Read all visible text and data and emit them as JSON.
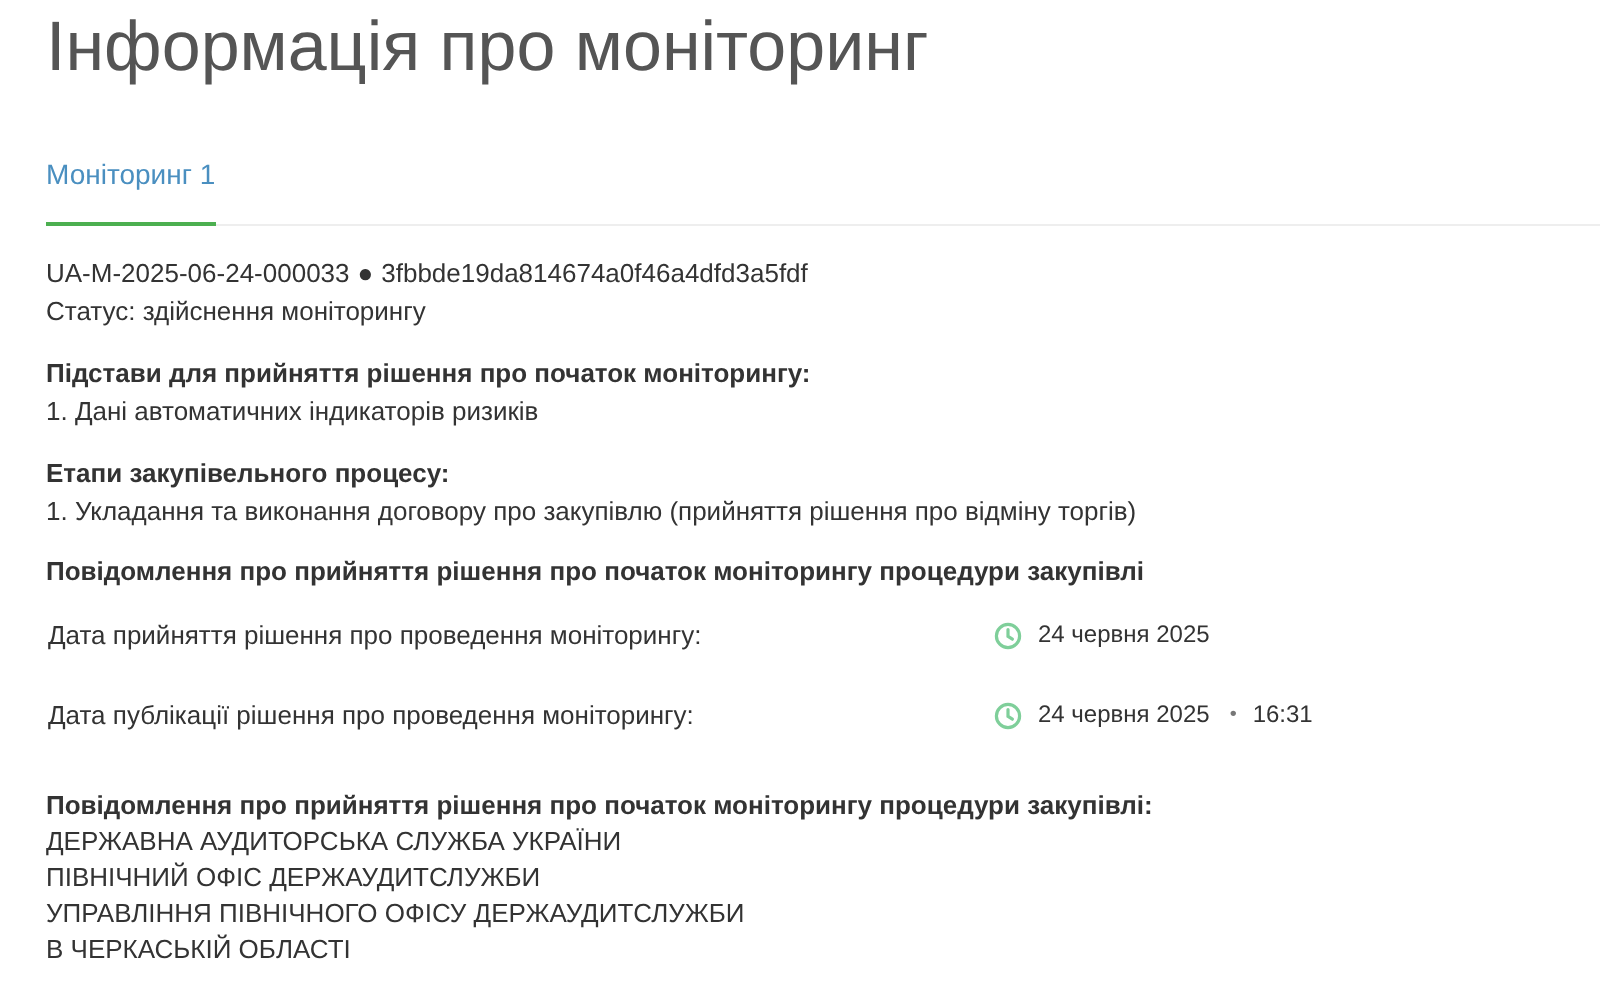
{
  "title": "Інформація про моніторинг",
  "tabs": [
    {
      "label": "Моніторинг 1",
      "selected": true
    }
  ],
  "monitoring": {
    "code": "UA-M-2025-06-24-000033",
    "separator": "●",
    "hash": "3fbbde19da814674a0f46a4dfd3a5fdf",
    "status": "Статус: здійснення моніторингу",
    "sections": [
      {
        "heading": "Підстави для прийняття рішення про початок моніторингу:",
        "items": [
          "1. Дані автоматичних індикаторів ризиків"
        ]
      },
      {
        "heading": "Етапи закупівельного процесу:",
        "items": [
          "1. Укладання та виконання договору про закупівлю (прийняття рішення про відміну торгів)"
        ]
      }
    ],
    "notice_heading": "Повідомлення про прийняття рішення про початок моніторингу процедури закупівлі",
    "dates": [
      {
        "label": "Дата прийняття рішення про проведення моніторингу:",
        "date": "24 червня 2025"
      },
      {
        "label": "Дата публікації рішення про проведення моніторингу:",
        "date": "24 червня 2025",
        "separator": "•",
        "time": "16:31"
      }
    ],
    "authority": {
      "heading": "Повідомлення про прийняття рішення про початок моніторингу процедури закупівлі:",
      "lines": [
        "ДЕРЖАВНА АУДИТОРСЬКА СЛУЖБА УКРАЇНИ",
        "ПІВНІЧНИЙ ОФІС ДЕРЖАУДИТСЛУЖБИ",
        "УПРАВЛІННЯ ПІВНІЧНОГО ОФІСУ ДЕРЖАУДИТСЛУЖБИ",
        "В ЧЕРКАСЬКІЙ ОБЛАСТІ"
      ]
    }
  }
}
